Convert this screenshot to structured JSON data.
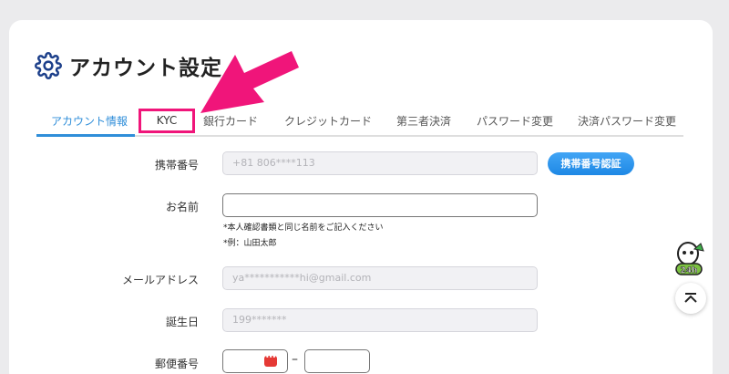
{
  "page": {
    "title": "アカウント設定",
    "icon": "gear-icon"
  },
  "tabs": [
    {
      "label": "アカウント情報",
      "active": true
    },
    {
      "label": "KYC",
      "active": false,
      "highlighted": true
    },
    {
      "label": "銀行カード",
      "active": false
    },
    {
      "label": "クレジットカード",
      "active": false
    },
    {
      "label": "第三者決済",
      "active": false
    },
    {
      "label": "パスワード変更",
      "active": false
    },
    {
      "label": "決済パスワード変更",
      "active": false
    }
  ],
  "form": {
    "phone": {
      "label": "携帯番号",
      "value": "+81 806****113",
      "button": "携帯番号認証"
    },
    "name": {
      "label": "お名前",
      "value": "",
      "note1": "*本人確認書類と同じ名前をご記入ください",
      "note2": "*例：山田太郎"
    },
    "email": {
      "label": "メールアドレス",
      "value": "ya***********hi@gmail.com"
    },
    "birthday": {
      "label": "誕生日",
      "value": "199*******"
    },
    "postal": {
      "label": "郵便番号",
      "separator": "–"
    }
  },
  "support": {
    "label": "24h"
  },
  "colors": {
    "accent": "#2f8ed9",
    "highlight": "#f0157a",
    "button": "#1e88e5"
  }
}
